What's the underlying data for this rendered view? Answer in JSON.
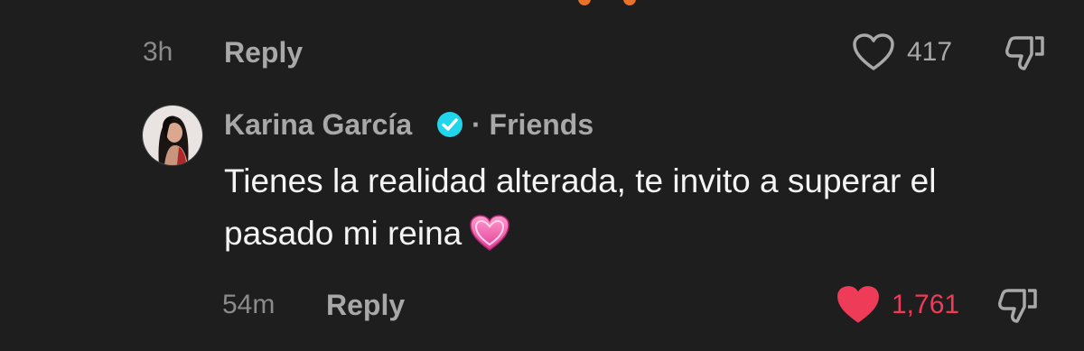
{
  "prev_comment": {
    "time": "3h",
    "reply_label": "Reply",
    "like_count": "417",
    "liked": false
  },
  "reply_comment": {
    "author": "Karina García",
    "verified": true,
    "relation": "· Friends",
    "text": "Tienes la realidad alterada, te invito a superar el pasado mi reina",
    "emoji": "pink-heart",
    "time": "54m",
    "reply_label": "Reply",
    "like_count": "1,761",
    "liked": true
  },
  "colors": {
    "background": "#1e1e1e",
    "liked_heart": "#ee3b57",
    "verified_badge": "#20d5ec",
    "muted_text": "#8b8b8b"
  },
  "icons": [
    "heart-outline-icon",
    "dislike-icon",
    "verified-badge-icon",
    "heart-filled-icon",
    "pink-heart-emoji"
  ]
}
